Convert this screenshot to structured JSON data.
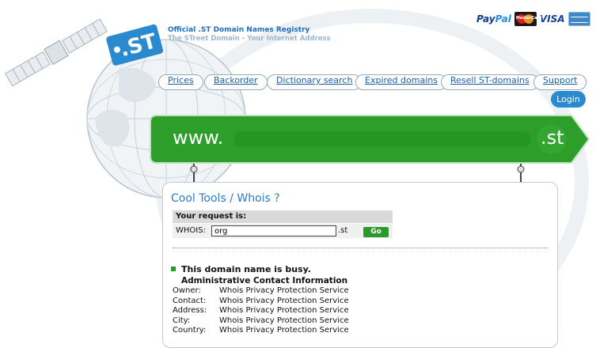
{
  "header": {
    "title": "Official .ST Domain Names Registry",
    "subtitle": "The STreet Domain - Your Internet Address",
    "logo_text": ".ST"
  },
  "payments": {
    "paypal_pay": "Pay",
    "paypal_pal": "Pal",
    "mastercard": "MasterCard",
    "visa": "VISA"
  },
  "nav": {
    "items": [
      {
        "label": "Prices"
      },
      {
        "label": "Backorder"
      },
      {
        "label": "Dictionary search"
      },
      {
        "label": "Expired domains"
      },
      {
        "label": "Resell ST-domains"
      },
      {
        "label": "Support"
      }
    ],
    "login": "Login"
  },
  "domain_bar": {
    "prefix": "www.",
    "suffix": ".st",
    "value": ""
  },
  "tools": {
    "title": "Cool Tools / Whois ?",
    "request_heading": "Your request is:",
    "whois_label": "WHOIS:",
    "whois_value": "org",
    "whois_suffix": ".st",
    "go_label": "Go"
  },
  "result": {
    "status": "This domain name is busy.",
    "section_heading": "Administrative Contact Information",
    "rows": [
      {
        "label": "Owner:",
        "value": "Whois Privacy Protection Service"
      },
      {
        "label": "Contact:",
        "value": "Whois Privacy Protection Service"
      },
      {
        "label": "Address:",
        "value": "Whois Privacy Protection Service"
      },
      {
        "label": "City:",
        "value": "Whois Privacy Protection Service"
      },
      {
        "label": "Country:",
        "value": "Whois Privacy Protection Service"
      }
    ]
  },
  "colors": {
    "accent_blue": "#2a7bbf",
    "bar_green": "#2e9e2a",
    "button_green": "#2a9a2a",
    "login_blue": "#2a8ad0"
  }
}
